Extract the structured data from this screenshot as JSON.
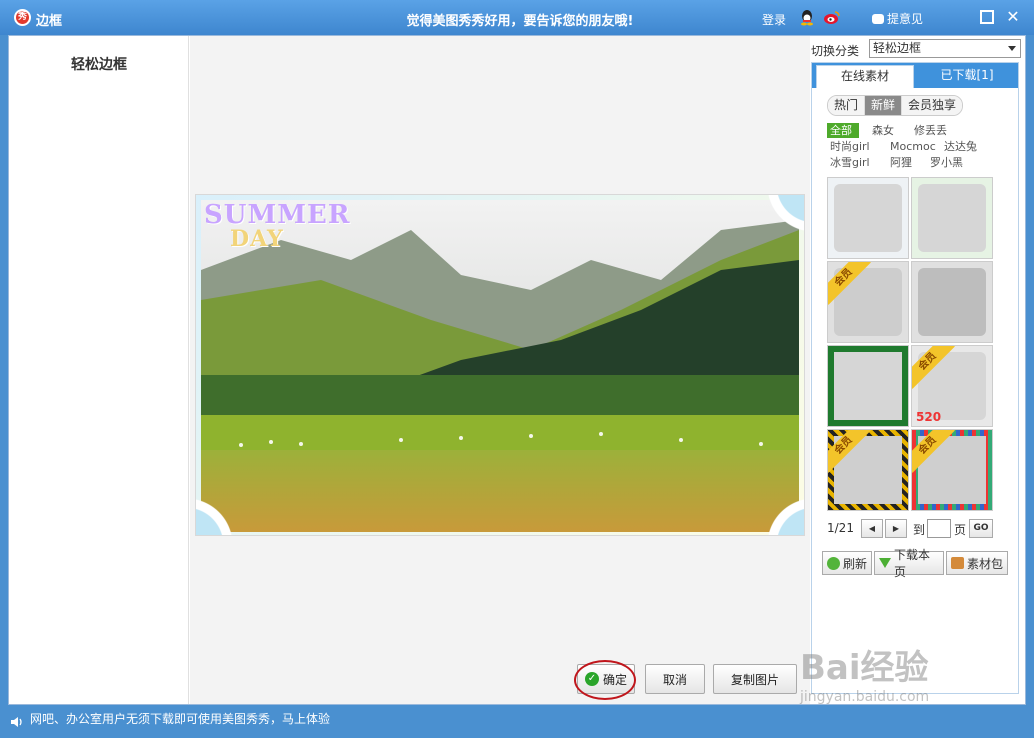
{
  "titlebar": {
    "logo_text": "秀",
    "title": "边框",
    "slogan": "觉得美图秀秀好用，要告诉您的朋友哦!",
    "login": "登录",
    "feedback": "提意见"
  },
  "left_panel": {
    "title": "轻松边框"
  },
  "preview": {
    "deco_line1": "SUMMER",
    "deco_line2": "DAY"
  },
  "buttons": {
    "ok": "确定",
    "cancel": "取消",
    "copy": "复制图片"
  },
  "right_panel": {
    "switch_label": "切换分类",
    "category_selected": "轻松边框",
    "tabs": {
      "online": "在线素材",
      "downloaded": "已下载[1]"
    },
    "filters": [
      "热门",
      "新鲜",
      "会员独享"
    ],
    "active_filter": "新鲜",
    "tags_row1": [
      "全部",
      "森女",
      "修丢丢"
    ],
    "tags_row2": [
      "时尚girl",
      "Mocmoc",
      "达达兔"
    ],
    "tags_row3": [
      "冰雪girl",
      "阿狸",
      "罗小黑"
    ],
    "vip_label": "会员",
    "thumb_text_520": "520",
    "pager": {
      "page": "1/21",
      "to": "到",
      "page_unit": "页",
      "go": "GO",
      "prev": "◀",
      "next": "▶"
    },
    "actions": {
      "refresh": "刷新",
      "download_page": "下载本页",
      "pack": "素材包"
    }
  },
  "watermark": {
    "logo": "Bai经验",
    "url": "jingyan.baidu.com"
  },
  "statusbar": {
    "text": "网吧、办公室用户无须下载即可使用美图秀秀，马上体验"
  },
  "colors": {
    "title_bar": "#3e86cf",
    "accent_tab": "#3f92dc",
    "vip": "#f3c42a",
    "ok_ring": "#c0161c",
    "tag_active": "#4eaa2b"
  }
}
